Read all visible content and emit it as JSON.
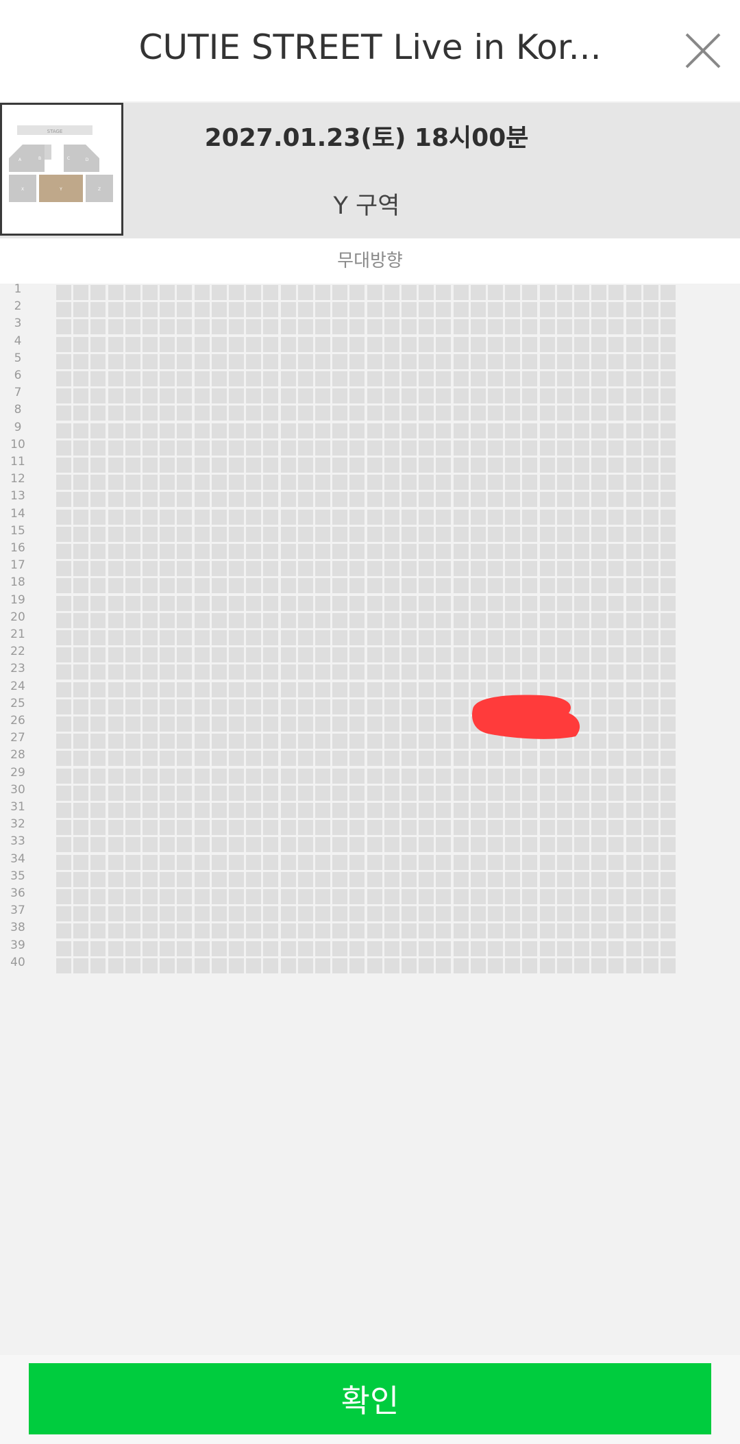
{
  "header": {
    "title": "CUTIE STREET Live in Kor...",
    "close_icon": "close-icon"
  },
  "performance": {
    "date_time": "2027.01.23(토) 18시00분",
    "zone": "Y 구역",
    "minimap": {
      "stage_label": "STAGE",
      "sections": [
        "A",
        "B",
        "C",
        "D",
        "X",
        "Y",
        "Z"
      ],
      "selected_section": "Y",
      "selected_color": "#bfa88a"
    }
  },
  "stage_direction": "무대방향",
  "seat_map": {
    "rows": [
      "1",
      "2",
      "3",
      "4",
      "5",
      "6",
      "7",
      "8",
      "9",
      "10",
      "11",
      "12",
      "13",
      "14",
      "15",
      "16",
      "17",
      "18",
      "19",
      "20",
      "21",
      "22",
      "23",
      "24",
      "25",
      "26",
      "27",
      "28",
      "29",
      "30",
      "31",
      "32",
      "33",
      "34",
      "35",
      "36",
      "37",
      "38",
      "39",
      "40"
    ],
    "seats_per_row": 36,
    "seat_color": "#dedede",
    "annotation_color": "#ff3b3b"
  },
  "footer": {
    "confirm_label": "확인",
    "confirm_color": "#00cc3e"
  }
}
